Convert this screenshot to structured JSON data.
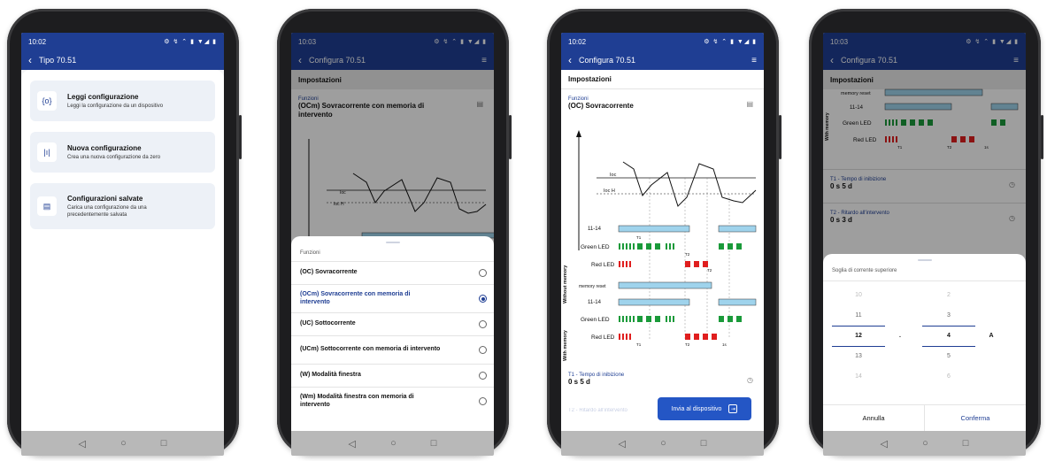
{
  "colors": {
    "brand": "#1f3e93",
    "button": "#2456c5",
    "green_led": "#1a9a3a",
    "red_led": "#e01e1e",
    "timeline": "#9fd3ec"
  },
  "phone1": {
    "status": {
      "time": "10:02",
      "icons": "⚙ ↯ ⌃ ▮ ▼◢ ▮"
    },
    "title": "Tipo 70.51",
    "cards": [
      {
        "icon": "{o}",
        "icon_name": "read-icon",
        "title": "Leggi configurazione",
        "subtitle": "Leggi la configurazione da un dispositivo"
      },
      {
        "icon": "|ı|",
        "icon_name": "sliders-icon",
        "title": "Nuova configurazione",
        "subtitle": "Crea una nuova configurazione da zero"
      },
      {
        "icon": "▤",
        "icon_name": "saved-icon",
        "title": "Configurazioni salvate",
        "subtitle": "Carica una configurazione da una precedentemente salvata"
      }
    ]
  },
  "phone2": {
    "status": {
      "time": "10:03",
      "icons": "⚙ ↯ ⌃ ▮ ▼◢ ▮"
    },
    "title": "Configura 70.51",
    "section": "Impostazioni",
    "field_label": "Funzioni",
    "field_value": "(OCm) Sovracorrente con memoria di intervento",
    "sheet_title": "Funzioni",
    "options": [
      {
        "label": "(OC) Sovracorrente",
        "selected": false
      },
      {
        "label": "(OCm) Sovracorrente con memoria di intervento",
        "selected": true
      },
      {
        "label": "(UC) Sottocorrente",
        "selected": false
      },
      {
        "label": "(UCm) Sottocorrente con memoria di intervento",
        "selected": false
      },
      {
        "label": "(W) Modalità finestra",
        "selected": false
      },
      {
        "label": "(Wm) Modalità finestra con memoria di intervento",
        "selected": false
      }
    ]
  },
  "phone3": {
    "status": {
      "time": "10:02",
      "icons": "⚙ ↯ ⌃ ▮ ▼◢ ▮"
    },
    "title": "Configura 70.51",
    "section": "Impostazioni",
    "field_label": "Funzioni",
    "field_value": "(OC) Sovracorrente",
    "diagram": {
      "ioc": "Ioc",
      "iocH": "Ioc H",
      "without_memory": "Without memory",
      "with_memory": "With memory",
      "rows": [
        "11-14",
        "Green LED",
        "Red LED",
        "memory reset"
      ],
      "t1": "T1",
      "t2": "T2",
      "one_s": "1s"
    },
    "t1_label": "T1 - Tempo di inibizione",
    "t1_value": "0 s 5 d",
    "t2_label": "T2 - Ritardo all'intervento",
    "t2_value": "0 s 3 d",
    "send_label": "Invia al dispositivo"
  },
  "phone4": {
    "status": {
      "time": "10:03",
      "icons": "⚙ ↯ ⌃ ▮ ▼◢ ▮"
    },
    "title": "Configura 70.51",
    "section": "Impostazioni",
    "diagram": {
      "rows": [
        "memory reset",
        "11-14",
        "Green LED",
        "Red LED"
      ],
      "with_memory": "With memory",
      "t1": "T1",
      "t2": "T2",
      "one_s": "1s"
    },
    "t1_label": "T1 - Tempo di inibizione",
    "t1_value": "0 s 5 d",
    "t2_label": "T2 - Ritardo all'intervento",
    "t2_value": "0 s 3 d",
    "sheet_title": "Soglia di corrente superiore",
    "col1": [
      "10",
      "11",
      "12",
      "13",
      "14"
    ],
    "col2": [
      "2",
      "3",
      "4",
      "5",
      "6"
    ],
    "separator": ".",
    "unit": "A",
    "cancel": "Annulla",
    "confirm": "Conferma"
  },
  "nav": {
    "back": "◁",
    "home": "○",
    "recent": "□"
  }
}
